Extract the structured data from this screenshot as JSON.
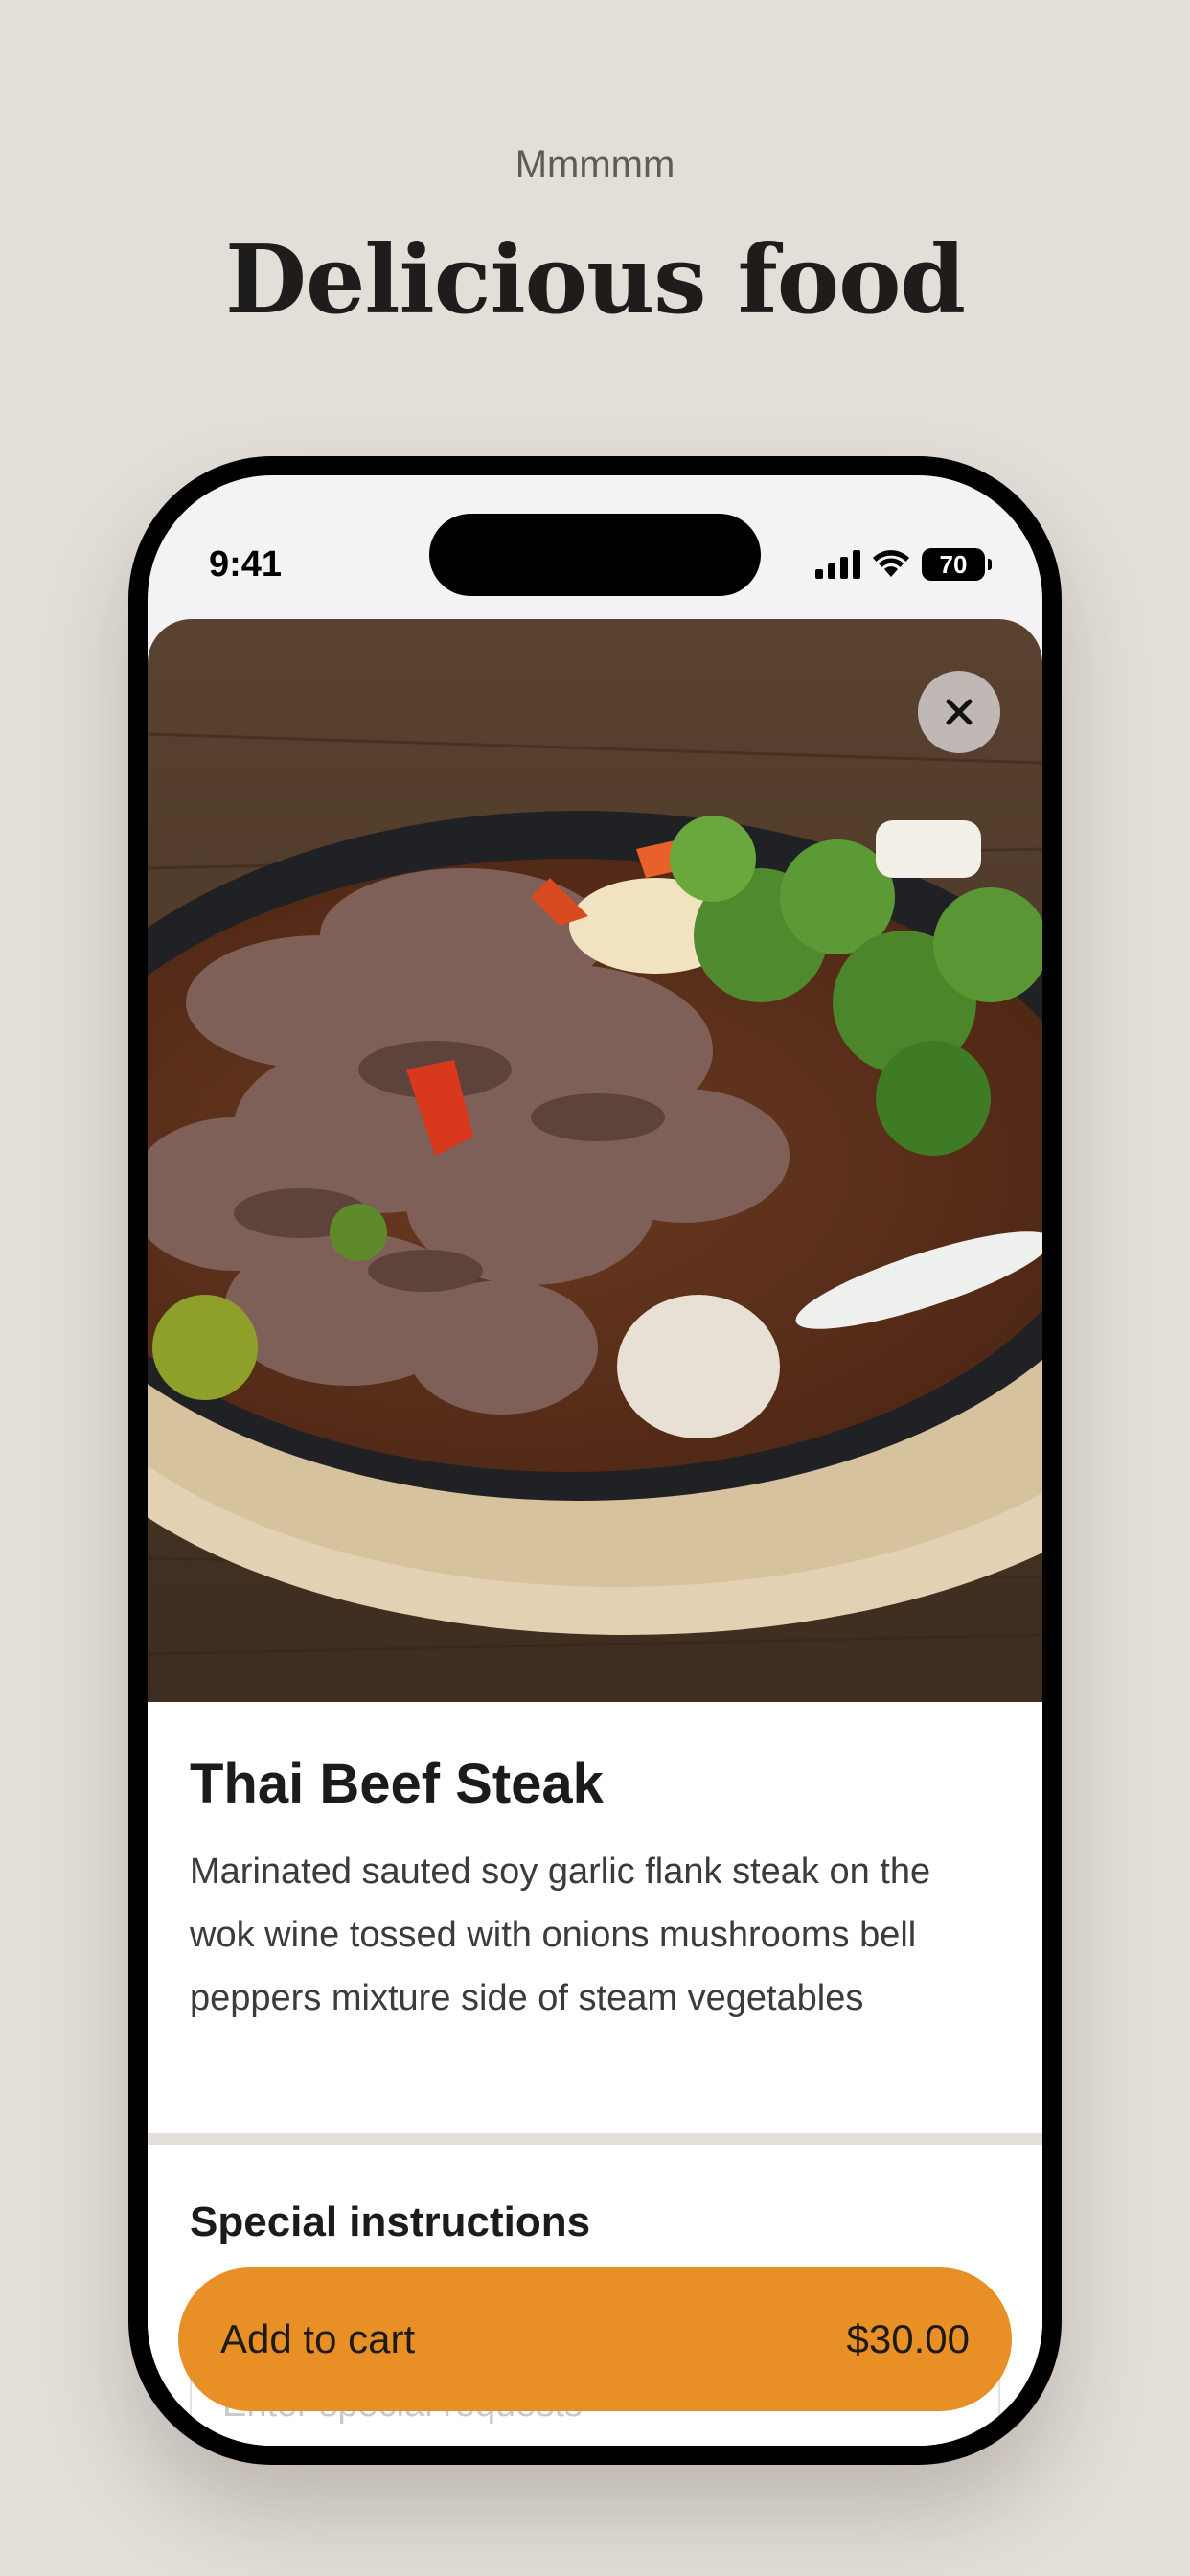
{
  "promo": {
    "eyebrow": "Mmmmm",
    "headline": "Delicious food"
  },
  "status_bar": {
    "time": "9:41",
    "battery": "70",
    "icons": [
      "cellular-signal-icon",
      "wifi-icon",
      "battery-icon"
    ]
  },
  "item": {
    "image_icon": "food-photo",
    "title": "Thai Beef Steak",
    "description": "Marinated sauted soy garlic flank steak on the wok wine tossed with onions mushrooms bell peppers mixture side of steam vegetables"
  },
  "special_instructions": {
    "title": "Special instructions",
    "placeholder": "Enter special requests"
  },
  "cart": {
    "label": "Add to cart",
    "price": "$30.00"
  },
  "colors": {
    "background": "#e3ded8",
    "accent": "#e88f26",
    "text": "#1d1b19"
  }
}
